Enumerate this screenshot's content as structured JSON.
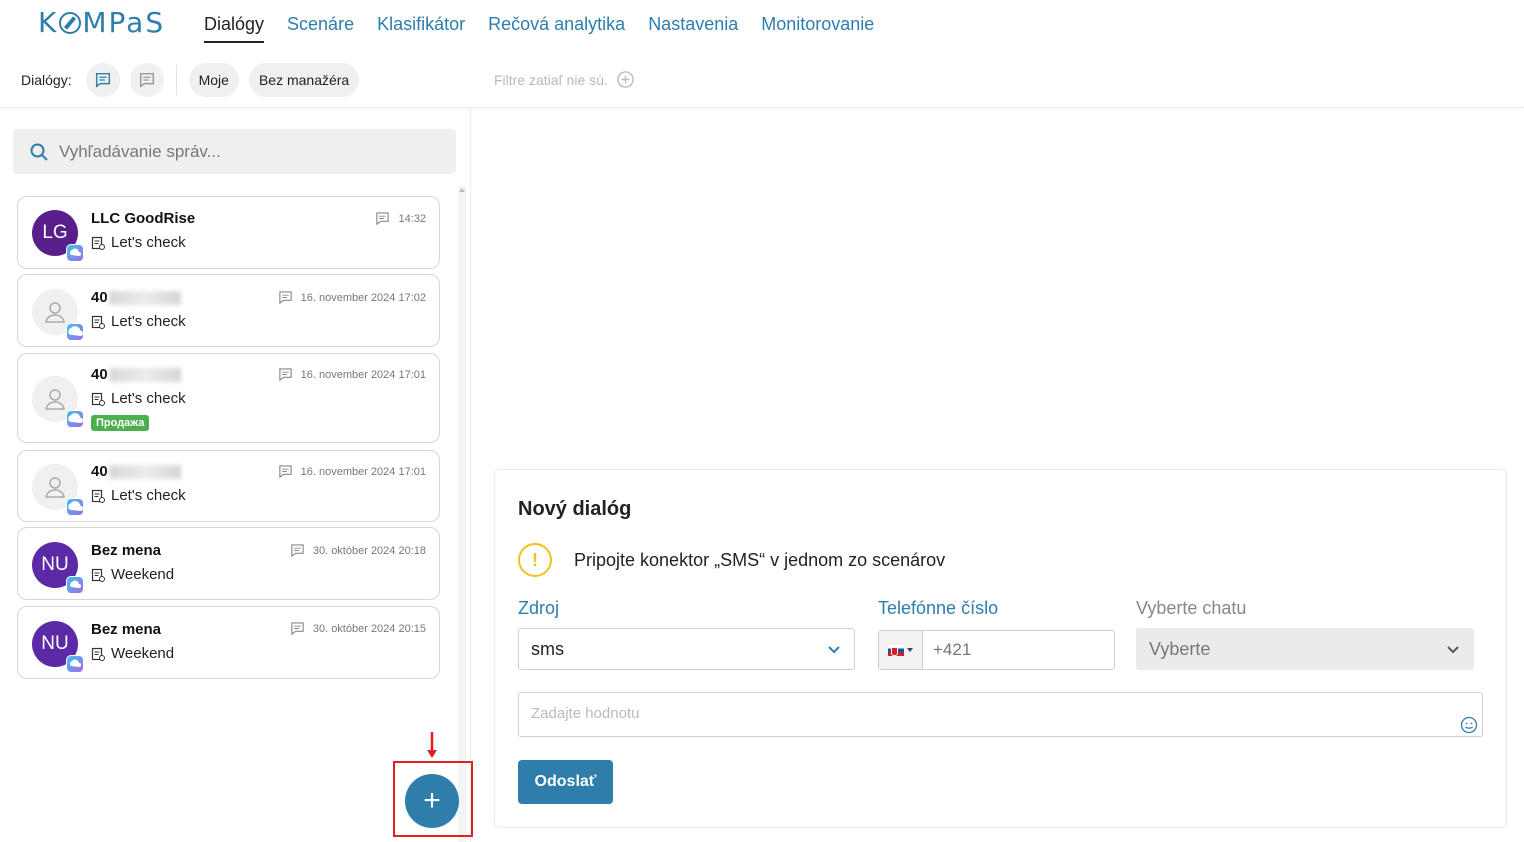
{
  "logo": "KOMPaS",
  "nav": [
    "Dialógy",
    "Scenáre",
    "Klasifikátor",
    "Rečová analytika",
    "Nastavenia",
    "Monitorovanie"
  ],
  "subbar": {
    "label": "Dialógy:",
    "chip_mine": "Moje",
    "chip_no_manager": "Bez manažéra",
    "filters_text": "Filtre zatiaľ nie sú."
  },
  "search": {
    "placeholder": "Vyhľadávanie správ..."
  },
  "dialogs": [
    {
      "initials": "LG",
      "name": "LLC GoodRise",
      "message": "Let's check",
      "time": "14:32",
      "avatar_color": "#5a1e8c"
    },
    {
      "initials": "",
      "name": "40",
      "message": "Let's check",
      "time": "16. november 2024 17:02"
    },
    {
      "initials": "",
      "name": "40",
      "message": "Let's check",
      "time": "16. november 2024 17:01",
      "tag": "Продажа"
    },
    {
      "initials": "",
      "name": "40",
      "message": "Let's check",
      "time": "16. november 2024 17:01"
    },
    {
      "initials": "NU",
      "name": "Bez mena",
      "message": "Weekend",
      "time": "30. október 2024 20:18",
      "avatar_color": "#5c2aa6"
    },
    {
      "initials": "NU",
      "name": "Bez mena",
      "message": "Weekend",
      "time": "30. október 2024 20:15",
      "avatar_color": "#5c2aa6"
    }
  ],
  "fab_label": "+",
  "new_dialog": {
    "title": "Nový dialóg",
    "warning": "Pripojte konektor „SMS“ v jednom zo scenárov",
    "source_label": "Zdroj",
    "source_value": "sms",
    "phone_label": "Telefónne číslo",
    "phone_value": "+421",
    "chat_label": "Vyberte chatu",
    "chat_value": "Vyberte",
    "message_placeholder": "Zadajte hodnotu",
    "send_label": "Odoslať"
  },
  "colors": {
    "primary": "#2e7dab",
    "warning": "#f4c020",
    "tag": "#4caf50",
    "highlight": "#e02020"
  }
}
